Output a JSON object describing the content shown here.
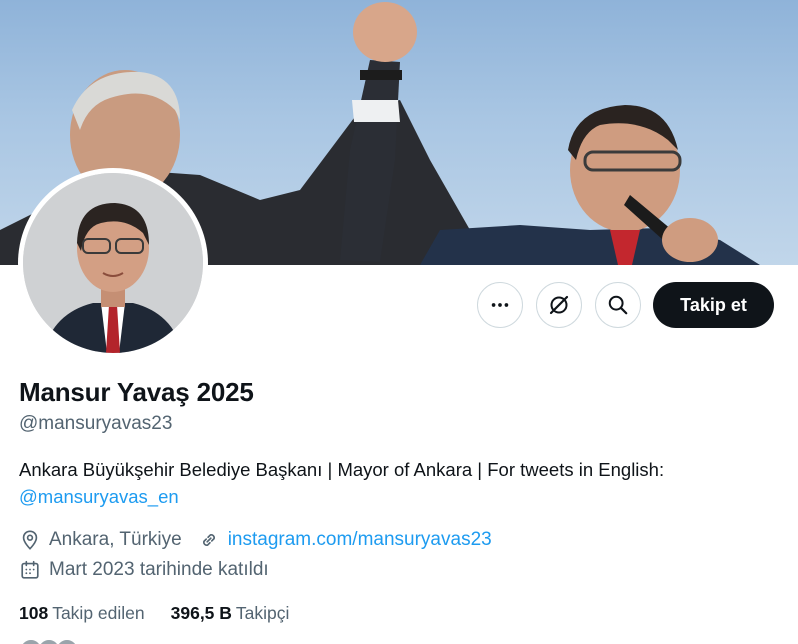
{
  "profile": {
    "display_name": "Mansur Yavaş 2025",
    "handle": "@mansuryavas23",
    "bio_text": "Ankara Büyükşehir Belediye Başkanı | Mayor of Ankara | For tweets in English: ",
    "bio_mention": "@mansuryavas_en",
    "location": "Ankara, Türkiye",
    "website": "instagram.com/mansuryavas23",
    "joined": "Mart 2023 tarihinde katıldı"
  },
  "actions": {
    "more_icon": "more-horizontal-icon",
    "grok_icon": "grok-icon",
    "search_icon": "search-icon",
    "follow_label": "Takip et"
  },
  "stats": {
    "following_count": "108",
    "following_label": "Takip edilen",
    "followers_count": "396,5 B",
    "followers_label": "Takipçi"
  },
  "colors": {
    "accent": "#1d9bf0",
    "text": "#0f1419",
    "muted": "#536471",
    "follow_button": "#0f1419"
  }
}
